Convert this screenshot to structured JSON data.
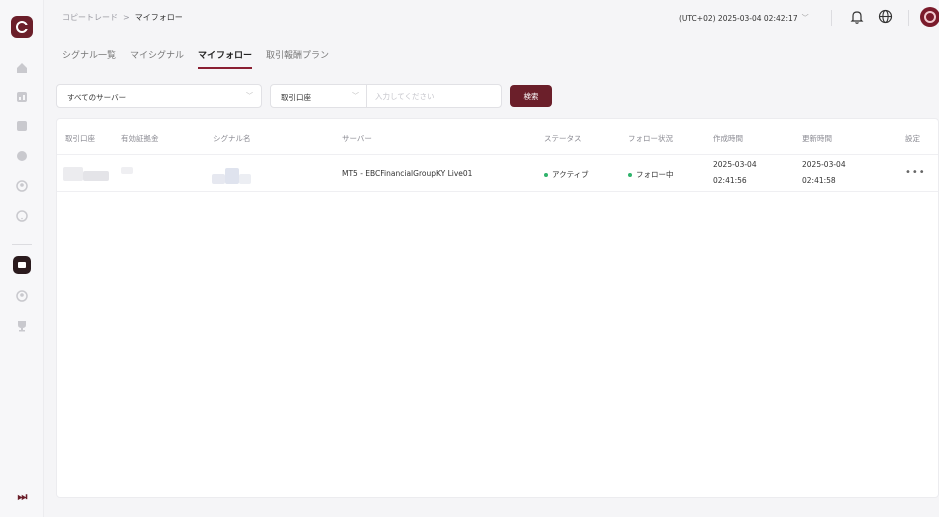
{
  "header": {
    "breadcrumb": {
      "parent": "コピートレード",
      "separator": ">",
      "current": "マイフォロー"
    },
    "datetime": "(UTC+02) 2025-03-04 02:42:17",
    "datetime_chevron": "﹀"
  },
  "sidebar": {
    "icons": [
      "home-icon",
      "chart-icon",
      "document-icon",
      "gift-icon",
      "user-icon",
      "help-icon",
      "copy-trade-icon",
      "account-icon",
      "trophy-icon"
    ],
    "collapse_label": "⏭"
  },
  "tabs": [
    {
      "label": "シグナル一覧",
      "active": false
    },
    {
      "label": "マイシグナル",
      "active": false
    },
    {
      "label": "マイフォロー",
      "active": true
    },
    {
      "label": "取引報酬プラン",
      "active": false
    }
  ],
  "filter": {
    "server_select": "すべてのサーバー",
    "account_type_select": "取引口座",
    "account_input_placeholder": "入力してください",
    "search_button": "検索"
  },
  "table": {
    "columns": [
      "取引口座",
      "有効証拠金",
      "シグナル名",
      "サーバー",
      "ステータス",
      "フォロー状況",
      "作成時間",
      "更新時間",
      "設定"
    ],
    "rows": [
      {
        "server": "MT5 - EBCFinancialGroupKY Live01",
        "status": "アクティブ",
        "follow_status": "フォロー中",
        "created_date": "2025-03-04",
        "created_time": "02:41:56",
        "updated_date": "2025-03-04",
        "updated_time": "02:41:58",
        "settings": "•••"
      }
    ]
  },
  "colors": {
    "accent": "#6b1f2a",
    "active_tab_underline": "#8a1f32",
    "status_green": "#2fb36b"
  }
}
